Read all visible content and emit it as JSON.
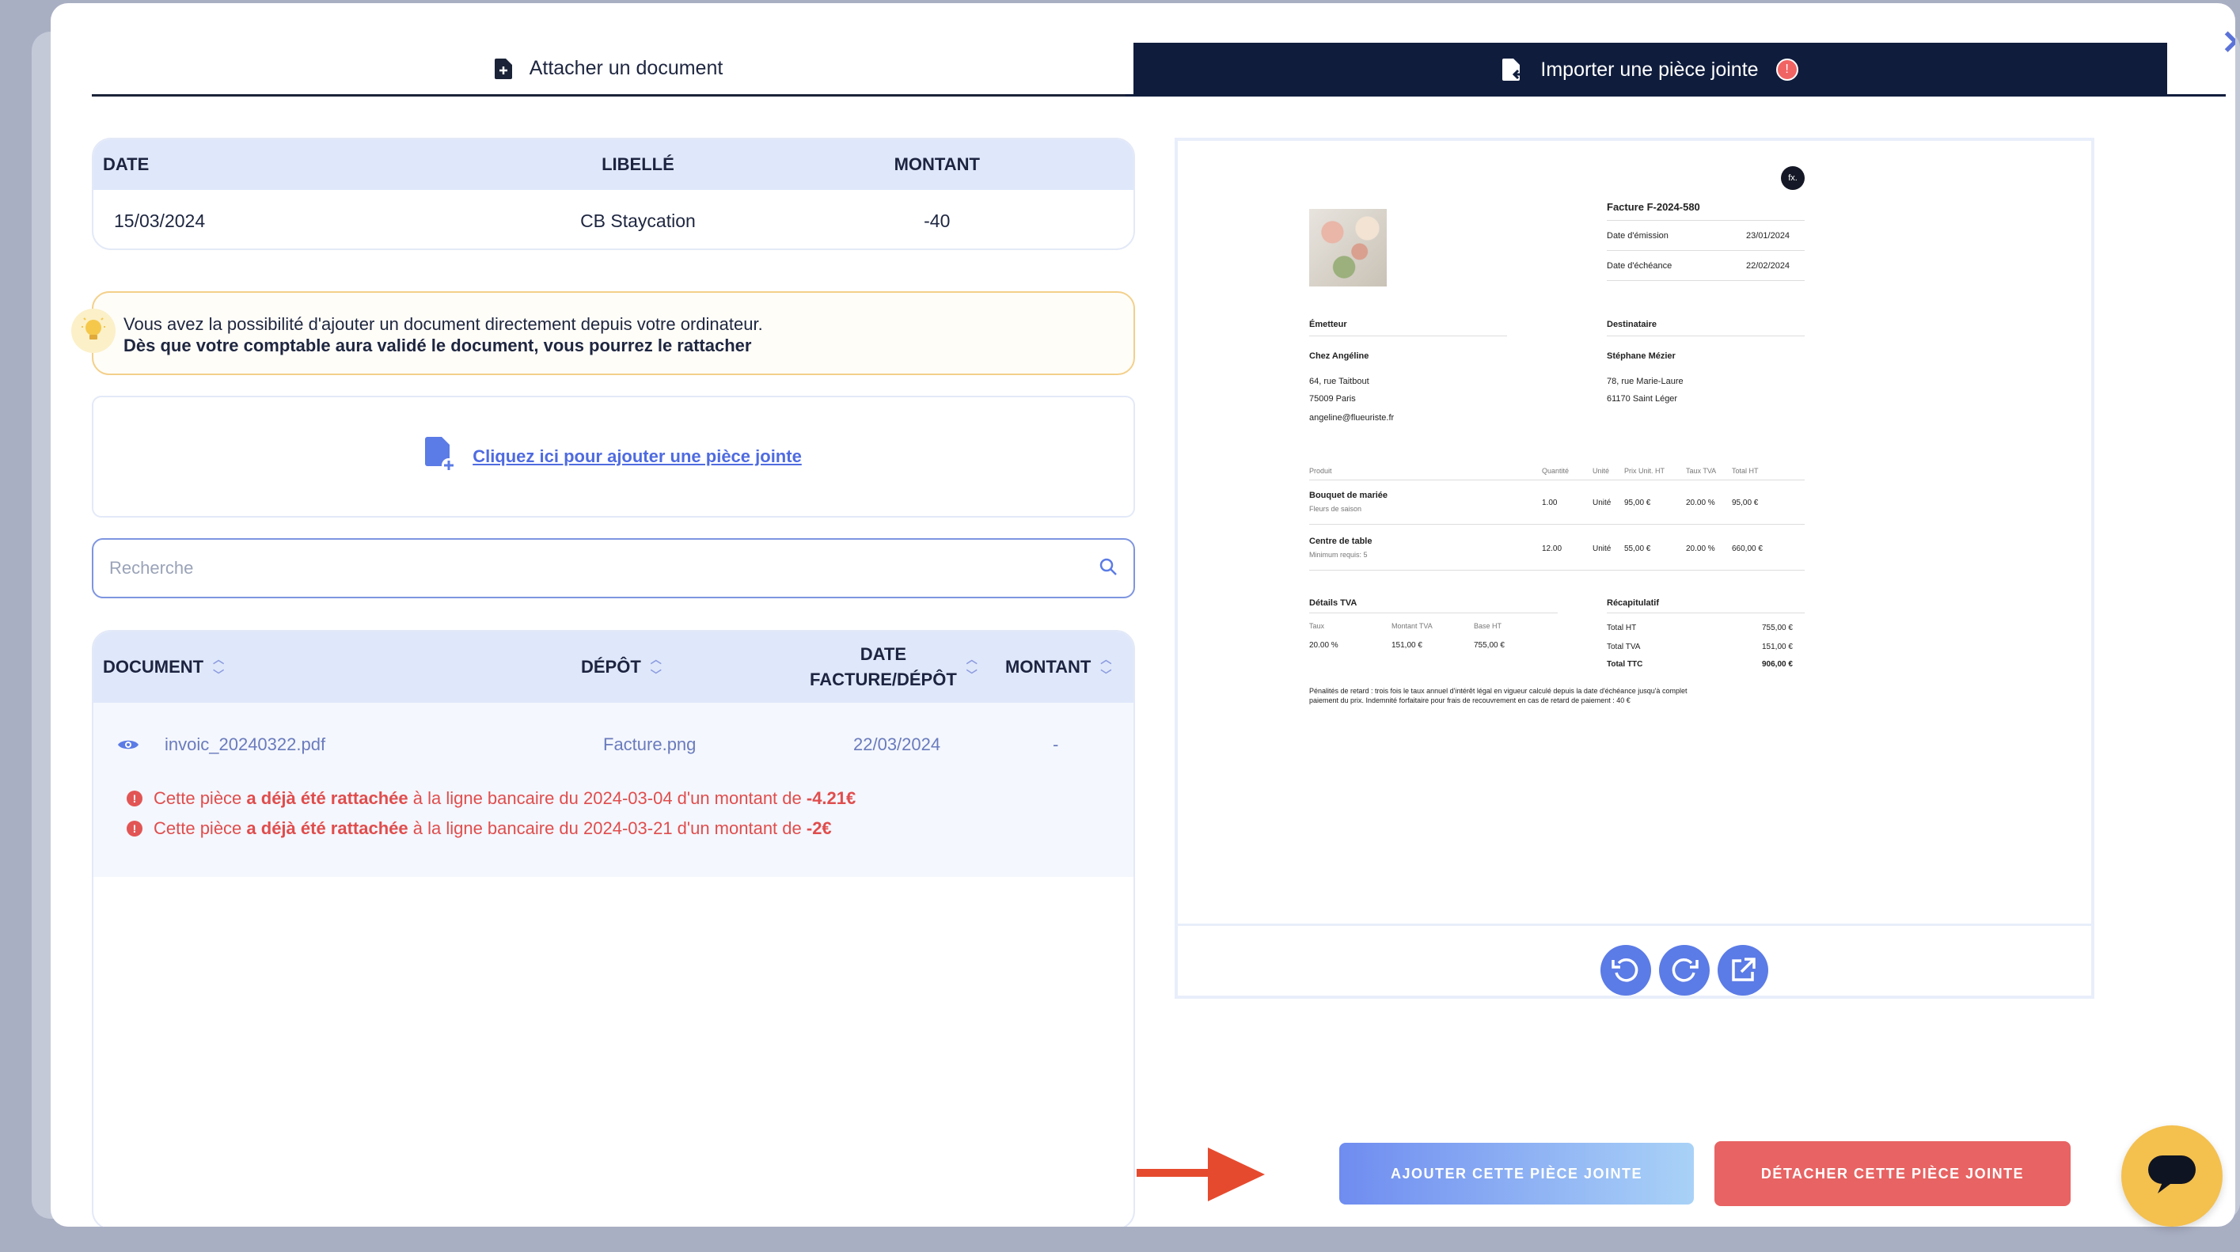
{
  "tabs": {
    "attach": {
      "label": "Attacher un document",
      "icon": "file-plus-icon"
    },
    "import": {
      "label": "Importer une pièce jointe",
      "icon": "file-import-icon",
      "badge": "!"
    }
  },
  "transaction_table": {
    "headers": [
      "DATE",
      "LIBELLÉ",
      "MONTANT"
    ],
    "row": {
      "date": "15/03/2024",
      "libelle": "CB Staycation",
      "montant": "-40"
    }
  },
  "info": {
    "line1": "Vous avez la possibilité d'ajouter un document directement depuis votre ordinateur.",
    "line2": "Dès que votre comptable aura validé le document, vous pourrez le rattacher",
    "icon": "lightbulb-icon"
  },
  "upload": {
    "link": "Cliquez ici pour ajouter une pièce jointe"
  },
  "search": {
    "placeholder": "Recherche"
  },
  "document_table": {
    "headers": {
      "document": "DOCUMENT",
      "depot": "DÉPÔT",
      "date_line1": "DATE",
      "date_line2": "FACTURE/DÉPÔT",
      "montant": "MONTANT"
    },
    "row": {
      "name": "invoic_20240322.pdf",
      "depot": "Facture.png",
      "date": "22/03/2024",
      "montant": "-"
    },
    "warnings": [
      {
        "pre": "Cette pièce ",
        "bold": "a déjà été rattachée",
        "mid": " à la ligne bancaire du 2024-03-04 d'un montant de ",
        "amount": "-4.21€"
      },
      {
        "pre": "Cette pièce ",
        "bold": "a déjà été rattachée",
        "mid": " à la ligne bancaire du 2024-03-21 d'un montant de ",
        "amount": "-2€"
      }
    ]
  },
  "invoice": {
    "logo": "fx.",
    "title": "Facture F-2024-580",
    "emission_label": "Date d'émission",
    "emission": "23/01/2024",
    "echeance_label": "Date d'échéance",
    "echeance": "22/02/2024",
    "emetteur_label": "Émetteur",
    "emetteur_name": "Chez Angéline",
    "emetteur_addr1": "64, rue Taitbout",
    "emetteur_addr2": "75009 Paris",
    "emetteur_email": "angeline@flueuriste.fr",
    "dest_label": "Destinataire",
    "dest_name": "Stéphane Mézier",
    "dest_addr1": "78, rue Marie-Laure",
    "dest_addr2": "61170 Saint Léger",
    "cols": [
      "Produit",
      "Quantité",
      "Unité",
      "Prix Unit. HT",
      "Taux TVA",
      "Total HT"
    ],
    "items": [
      {
        "name": "Bouquet de mariée",
        "sub": "Fleurs de saison",
        "qty": "1.00",
        "unit": "Unité",
        "price": "95,00 €",
        "tva": "20.00 %",
        "total": "95,00 €"
      },
      {
        "name": "Centre de table",
        "sub": "Minimum requis: 5",
        "qty": "12.00",
        "unit": "Unité",
        "price": "55,00 €",
        "tva": "20.00 %",
        "total": "660,00 €"
      }
    ],
    "tva_label": "Détails TVA",
    "tva_cols": [
      "Taux",
      "Montant TVA",
      "Base HT"
    ],
    "tva_vals": [
      "20.00 %",
      "151,00 €",
      "755,00 €"
    ],
    "recap_label": "Récapitulatif",
    "total_ht_label": "Total HT",
    "total_ht": "755,00 €",
    "total_tva_label": "Total TVA",
    "total_tva": "151,00 €",
    "total_ttc_label": "Total TTC",
    "total_ttc": "906,00 €",
    "footer1": "Pénalités de retard : trois fois le taux annuel d'intérêt légal en vigueur calculé depuis la date d'échéance jusqu'à complet",
    "footer2": "paiement du prix. Indemnité forfaitaire pour frais de recouvrement en cas de retard de paiement : 40 €"
  },
  "preview_controls": [
    "rotate-left-icon",
    "rotate-right-icon",
    "external-link-icon"
  ],
  "actions": {
    "add": "AJOUTER CETTE PIÈCE JOINTE",
    "detach": "DÉTACHER CETTE PIÈCE JOINTE"
  },
  "colors": {
    "accent": "#5b7be6",
    "navy": "#0f1c3c",
    "danger": "#e86363",
    "warning": "#e04d4d",
    "chat": "#f4c04e"
  }
}
